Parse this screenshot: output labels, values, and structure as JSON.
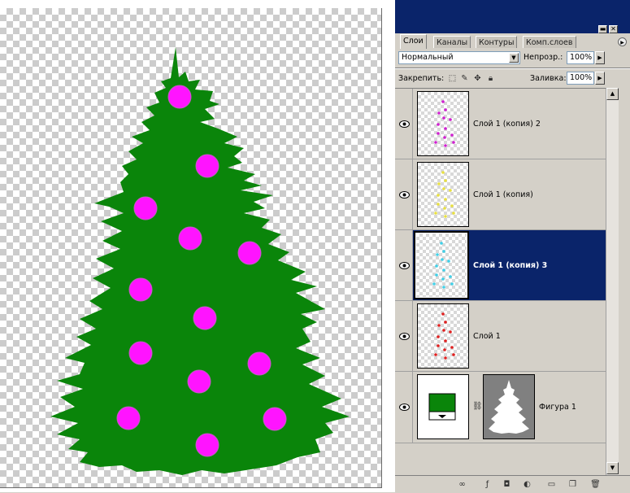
{
  "colors": {
    "tree_green": "#0a850a",
    "ornament_magenta": "#ff14ff",
    "panel_title": "#0a246a",
    "selection": "#0a246a"
  },
  "panel": {
    "window_buttons": {
      "minimize": "▬",
      "close": "✕"
    },
    "tabs": [
      {
        "label": "Слои",
        "active": true
      },
      {
        "label": "Каналы",
        "active": false
      },
      {
        "label": "Контуры",
        "active": false
      },
      {
        "label": "Комп.слоев",
        "active": false
      }
    ],
    "blend_mode": "Нормальный",
    "opacity_label": "Непрозр.:",
    "opacity_value": "100%",
    "lock_label": "Закрепить:",
    "fill_label": "Заливка:",
    "fill_value": "100%",
    "layers": [
      {
        "name": "Слой 1 (копия) 2",
        "dot_color": "#d020d0",
        "selected": false,
        "visible": true
      },
      {
        "name": "Слой 1 (копия)",
        "dot_color": "#e8e040",
        "selected": false,
        "visible": true
      },
      {
        "name": "Слой 1 (копия) 3",
        "dot_color": "#40d0e8",
        "selected": true,
        "visible": true
      },
      {
        "name": "Слой 1",
        "dot_color": "#e02020",
        "selected": false,
        "visible": true
      },
      {
        "name": "Фигура 1",
        "selected": false,
        "visible": true,
        "type": "shape"
      }
    ],
    "bottom_icons": [
      "link-icon",
      "layer-style-icon",
      "mask-icon",
      "adjustment-icon",
      "folder-icon",
      "new-layer-icon",
      "trash-icon"
    ]
  }
}
